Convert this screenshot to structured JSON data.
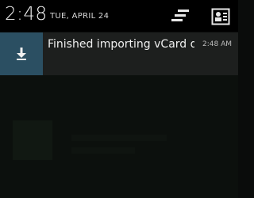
{
  "status_bar": {
    "time": "2:48",
    "date": "TUE, APRIL 24",
    "icons": [
      "quick-settings-icon",
      "user-profile-icon"
    ]
  },
  "notification": {
    "icon": "download-icon",
    "title": "Finished importing vCard ds",
    "time": "2:48 AM"
  },
  "colors": {
    "header_bg": "#000000",
    "notification_bg": "#1d1f1e",
    "notification_icon_bg": "#2b4f62"
  }
}
